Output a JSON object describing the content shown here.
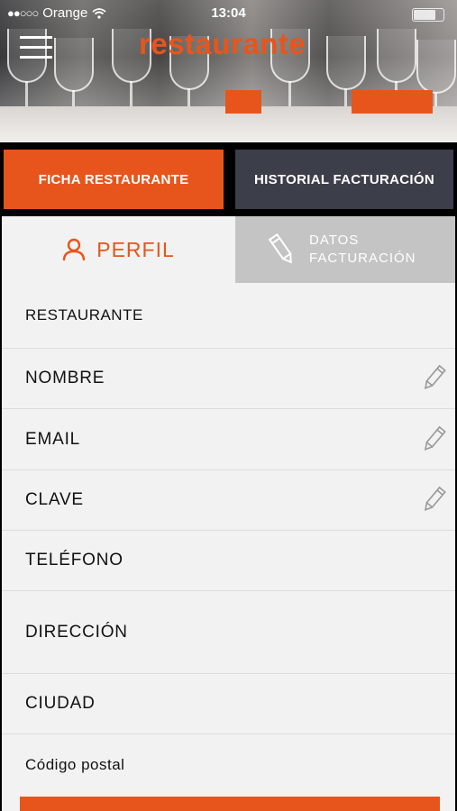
{
  "status_bar": {
    "signal": "●●○○○",
    "carrier": "Orange",
    "time": "13:04"
  },
  "header": {
    "title": "restaurante"
  },
  "top_tabs": [
    {
      "label": "FICHA RESTAURANTE",
      "active": true
    },
    {
      "label": "HISTORIAL FACTURACIÓN",
      "active": false
    }
  ],
  "sub_tabs": {
    "perfil": "PERFIL",
    "datos_line1": "DATOS",
    "datos_line2": "FACTURACIÓN"
  },
  "form_rows": [
    {
      "label": "RESTAURANTE",
      "editable": false
    },
    {
      "label": "NOMBRE",
      "editable": true
    },
    {
      "label": "EMAIL",
      "editable": true
    },
    {
      "label": "CLAVE",
      "editable": true
    },
    {
      "label": "TELÉFONO",
      "editable": false
    },
    {
      "label": "DIRECCIÓN",
      "editable": false
    },
    {
      "label": "CIUDAD",
      "editable": false
    },
    {
      "label": "Código postal",
      "editable": false
    }
  ],
  "colors": {
    "accent": "#e8551c",
    "dark_tab": "#3c3f49",
    "inactive_tab": "#c4c4c4",
    "background": "#f2f2f2"
  },
  "icons": {
    "menu": "hamburger-menu-icon",
    "profile": "user-icon",
    "edit": "pencil-icon",
    "wifi": "wifi-icon",
    "battery": "battery-icon"
  }
}
